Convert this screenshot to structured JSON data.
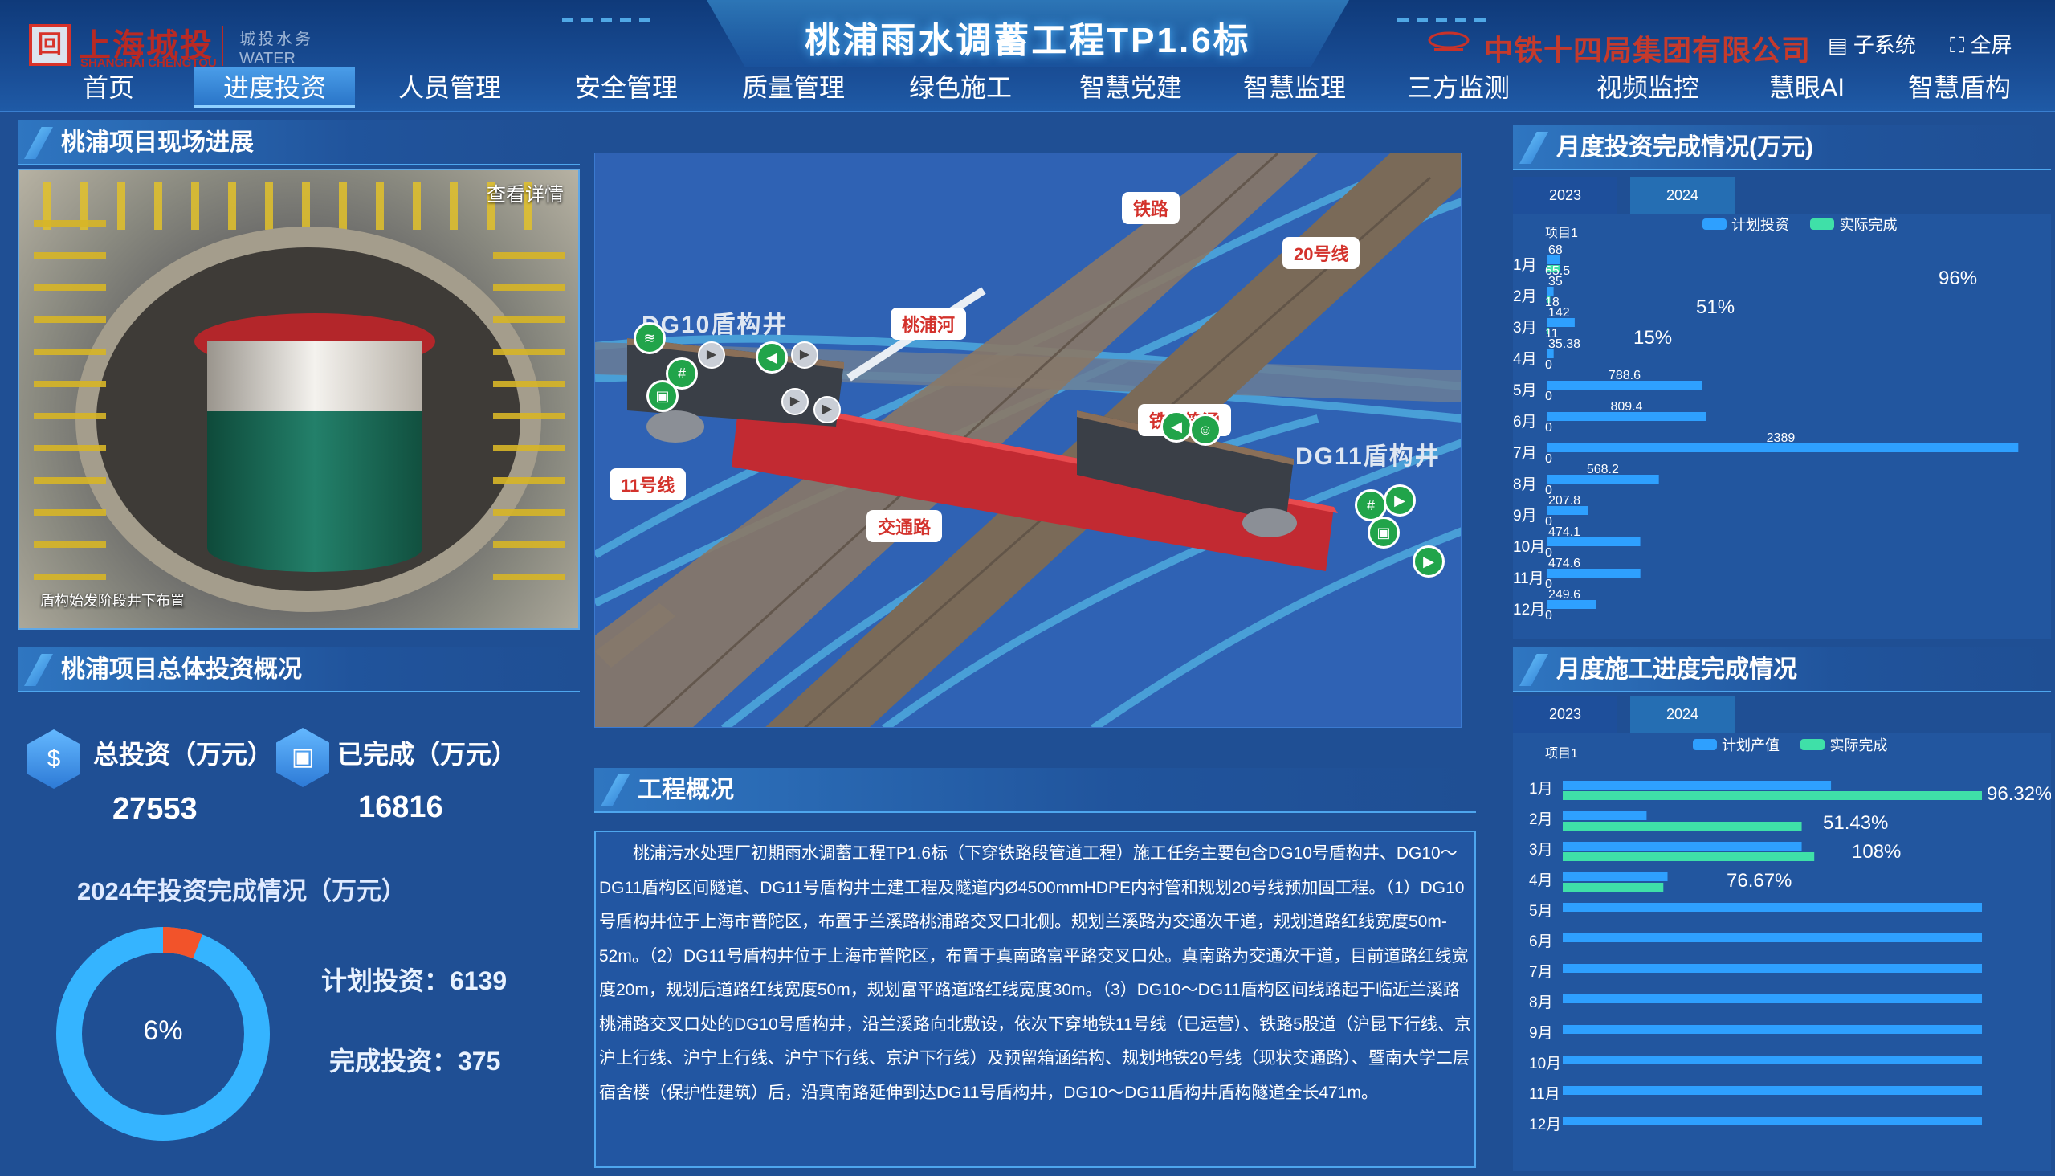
{
  "header": {
    "logo_cn": "上海城投",
    "logo_en": "SHANGHAI CHENGTOU",
    "logo_water_cn": "城投水务",
    "logo_water_en": "WATER",
    "title": "桃浦雨水调蓄工程TP1.6标",
    "company": "中铁十四局集团有限公司",
    "subsystem": "子系统",
    "fullscreen": "全屏"
  },
  "nav": [
    "首页",
    "进度投资",
    "人员管理",
    "安全管理",
    "质量管理",
    "绿色施工",
    "智慧党建",
    "智慧监理",
    "三方监测",
    "视频监控",
    "慧眼AI",
    "智慧盾构"
  ],
  "nav_active": "进度投资",
  "left": {
    "progress_title": "桃浦项目现场进展",
    "photo_link": "查看详情",
    "photo_caption": "盾构始发阶段井下布置",
    "investment_title": "桃浦项目总体投资概况",
    "total_label": "总投资（万元）",
    "total_value": "27553",
    "done_label": "已完成（万元）",
    "done_value": "16816",
    "year_title": "2024年投资完成情况（万元）",
    "donut_pct": "6%",
    "donut_fraction": 0.06,
    "plan_text": "计划投资：6139",
    "complete_text": "完成投资：375"
  },
  "scene": {
    "tags": [
      "铁路",
      "20号线",
      "桃浦河",
      "11号线",
      "交通路",
      "铁路箱涵"
    ],
    "shaft_left": "DG10盾构井",
    "shaft_right": "DG11盾构井"
  },
  "overview": {
    "title": "工程概况",
    "text": "桃浦污水处理厂初期雨水调蓄工程TP1.6标（下穿铁路段管道工程）施工任务主要包含DG10号盾构井、DG10～DG11盾构区间隧道、DG11号盾构井土建工程及隧道内Ø4500mmHDPE内衬管和规划20号线预加固工程。（1）DG10号盾构井位于上海市普陀区，布置于兰溪路桃浦路交叉口北侧。规划兰溪路为交通次干道，规划道路红线宽度50m-52m。（2）DG11号盾构井位于上海市普陀区，布置于真南路富平路交叉口处。真南路为交通次干道，目前道路红线宽度20m，规划后道路红线宽度50m，规划富平路道路红线宽度30m。（3）DG10～DG11盾构区间线路起于临近兰溪路桃浦路交叉口处的DG10号盾构井，沿兰溪路向北敷设，依次下穿地铁11号线（已运营）、铁路5股道（沪昆下行线、京沪上行线、沪宁上行线、沪宁下行线、京沪下行线）及预留箱涵结构、规划地铁20号线（现状交通路）、暨南大学二层宿舍楼（保护性建筑）后，沿真南路延伸到达DG11号盾构井，DG10～DG11盾构井盾构隧道全长471m。"
  },
  "investment_chart": {
    "title": "月度投资完成情况(万元)",
    "tabs": [
      "2023",
      "2024"
    ],
    "active_tab": "2024",
    "item_label": "项目1",
    "legend": [
      "计划投资",
      "实际完成"
    ],
    "colors": {
      "plan": "#2ea0ff",
      "actual": "#3fe0a8"
    }
  },
  "chart_data": [
    {
      "type": "bar",
      "title": "月度投资完成情况(万元)",
      "orientation": "horizontal",
      "categories": [
        "1月",
        "2月",
        "3月",
        "4月",
        "5月",
        "6月",
        "7月",
        "8月",
        "9月",
        "10月",
        "11月",
        "12月"
      ],
      "series": [
        {
          "name": "计划投资",
          "values": [
            68,
            35,
            142,
            35.38,
            788.6,
            809.4,
            2389,
            568.2,
            207.8,
            474.1,
            474.6,
            249.6
          ]
        },
        {
          "name": "实际完成",
          "values": [
            65.5,
            18,
            11,
            0,
            0,
            0,
            0,
            0,
            0,
            0,
            0,
            0
          ]
        }
      ],
      "plan_labels": [
        "68",
        "35",
        "142",
        "35.38",
        "788.6",
        "809.4",
        "2389",
        "568.2",
        "207.8",
        "474.1",
        "474.6",
        "249.6"
      ],
      "actual_labels": [
        "65.5",
        "18",
        "11",
        "0",
        "0",
        "0",
        "0",
        "0",
        "0",
        "0",
        "0",
        "0"
      ],
      "rate_labels": [
        {
          "month": "1月",
          "text": "96%"
        },
        {
          "month": "2月",
          "text": "51%"
        },
        {
          "month": "3月",
          "text": "15%"
        }
      ],
      "xlim": [
        0,
        2400
      ]
    },
    {
      "type": "bar",
      "title": "月度施工进度完成情况",
      "orientation": "horizontal",
      "categories": [
        "1月",
        "2月",
        "3月",
        "4月",
        "5月",
        "6月",
        "7月",
        "8月",
        "9月",
        "10月",
        "11月",
        "12月"
      ],
      "series": [
        {
          "name": "计划产值",
          "values": [
            0.64,
            0.2,
            0.57,
            0.25,
            1,
            1,
            1,
            1,
            1,
            1,
            1,
            1
          ]
        },
        {
          "name": "实际完成",
          "values": [
            1,
            0.57,
            0.6,
            0.24,
            0,
            0,
            0,
            0,
            0,
            0,
            0,
            0
          ]
        }
      ],
      "rate_labels": [
        {
          "month": "1月",
          "text": "96.32%"
        },
        {
          "month": "2月",
          "text": "51.43%"
        },
        {
          "month": "3月",
          "text": "108%"
        },
        {
          "month": "4月",
          "text": "76.67%"
        }
      ]
    }
  ],
  "progress_chart": {
    "title": "月度施工进度完成情况",
    "tabs": [
      "2023",
      "2024"
    ],
    "active_tab": "2024",
    "item_label": "项目1",
    "legend": [
      "计划产值",
      "实际完成"
    ]
  }
}
